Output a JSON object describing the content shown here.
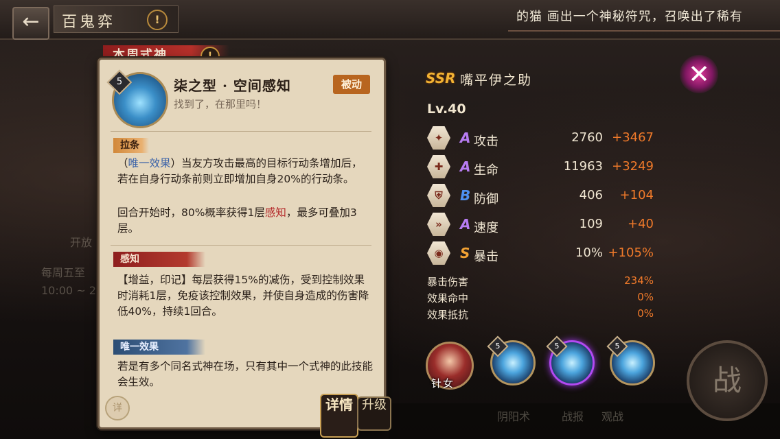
{
  "topbar": {
    "back_icon": "←",
    "title": "百鬼弈",
    "marquee": "的猫 画出一个神秘符咒，召唤出了稀有"
  },
  "background": {
    "ghost_texts": [
      "开放",
      "每周五至",
      "10:00 ~ 2"
    ],
    "bottom_ghost": [
      "阴阳术",
      "战报",
      "观战"
    ],
    "fight_label": "战"
  },
  "card": {
    "banner": "本周式神",
    "skill": {
      "level": "5",
      "name": "柒之型 · 空间感知",
      "quote": "找到了，在那里吗！",
      "type": "被动"
    },
    "section1": {
      "tag": "拉条",
      "p1_prefix": "（",
      "p1_link": "唯一效果",
      "p1_rest": "）当友方攻击最高的目标行动条增加后，若在自身行动条前则立即增加自身20%的行动条。",
      "p2_before": "回合开始时，80%概率获得1层",
      "p2_keyword": "感知",
      "p2_after": "，最多可叠加3层。"
    },
    "section2": {
      "tag": "感知",
      "text": "【增益，印记】每层获得15%的减伤，受到控制效果时消耗1层，免疫该控制效果，并使自身造成的伤害降低40%，持续1回合。"
    },
    "section3": {
      "tag": "唯一效果",
      "text": "若是有多个同名式神在场，只有其中一个式神的此技能会生效。"
    },
    "detail_round": "详"
  },
  "tabs": {
    "detail": "详情",
    "upgrade": "升级"
  },
  "hero": {
    "rarity": "SSR",
    "name": "嘴平伊之助",
    "level": "Lv.40",
    "stats": [
      {
        "icon": "attack-icon",
        "glyph": "✦",
        "grade": "A",
        "grade_color": "#b77cf2",
        "label": "攻击",
        "base": "2760",
        "bonus": "+3467"
      },
      {
        "icon": "health-icon",
        "glyph": "✚",
        "grade": "A",
        "grade_color": "#b77cf2",
        "label": "生命",
        "base": "11963",
        "bonus": "+3249"
      },
      {
        "icon": "defense-icon",
        "glyph": "⛨",
        "grade": "B",
        "grade_color": "#4e8ff0",
        "label": "防御",
        "base": "406",
        "bonus": "+104"
      },
      {
        "icon": "speed-icon",
        "glyph": "»",
        "grade": "A",
        "grade_color": "#b77cf2",
        "label": "速度",
        "base": "109",
        "bonus": "+40"
      },
      {
        "icon": "crit-icon",
        "glyph": "◉",
        "grade": "S",
        "grade_color": "#f2a233",
        "label": "暴击",
        "base": "10%",
        "bonus": "+105%"
      }
    ],
    "sub_stats": [
      {
        "label": "暴击伤害",
        "value": "234%"
      },
      {
        "label": "效果命中",
        "value": "0%"
      },
      {
        "label": "效果抵抗",
        "value": "0%"
      }
    ],
    "partner_name": "针女",
    "skill_levels": [
      "5",
      "5",
      "5"
    ]
  },
  "close_icon": "✕"
}
